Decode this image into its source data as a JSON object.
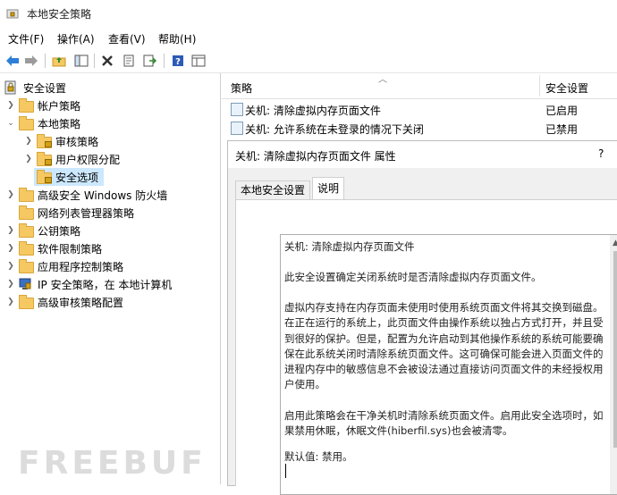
{
  "window": {
    "title": "本地安全策略"
  },
  "menu": [
    "文件(F)",
    "操作(A)",
    "查看(V)",
    "帮助(H)"
  ],
  "toolbar": {
    "icons": [
      "back-icon",
      "forward-icon",
      "up-folder-icon",
      "show-tree-icon",
      "delete-icon",
      "properties-icon",
      "export-icon",
      "help-icon",
      "view-icon"
    ]
  },
  "tree": {
    "root": "安全设置",
    "items": [
      {
        "label": "帐户策略",
        "level": 1,
        "expanded": false
      },
      {
        "label": "本地策略",
        "level": 1,
        "expanded": true
      },
      {
        "label": "审核策略",
        "level": 2,
        "expanded": false
      },
      {
        "label": "用户权限分配",
        "level": 2,
        "expanded": false
      },
      {
        "label": "安全选项",
        "level": 2,
        "selected": true
      },
      {
        "label": "高级安全 Windows 防火墙",
        "level": 1,
        "expanded": false
      },
      {
        "label": "网络列表管理器策略",
        "level": 1
      },
      {
        "label": "公钥策略",
        "level": 1,
        "expanded": false
      },
      {
        "label": "软件限制策略",
        "level": 1,
        "expanded": false
      },
      {
        "label": "应用程序控制策略",
        "level": 1,
        "expanded": false
      },
      {
        "label": "IP 安全策略，在 本地计算机",
        "level": 1,
        "expanded": false
      },
      {
        "label": "高级审核策略配置",
        "level": 1,
        "expanded": false
      }
    ]
  },
  "list": {
    "columns": [
      "策略",
      "安全设置"
    ],
    "rows": [
      {
        "name": "关机: 清除虚拟内存页面文件",
        "value": "已启用"
      },
      {
        "name": "关机: 允许系统在未登录的情况下关闭",
        "value": "已禁用"
      }
    ]
  },
  "dialog": {
    "title": "关机: 清除虚拟内存页面文件 属性",
    "help": "?",
    "tabs": [
      "本地安全设置",
      "说明"
    ],
    "active_tab": 1,
    "explain": {
      "p1": "关机: 清除虚拟内存页面文件",
      "p2": "此安全设置确定关闭系统时是否清除虚拟内存页面文件。",
      "p3": "虚拟内存支持在内存页面未使用时使用系统页面文件将其交换到磁盘。在正在运行的系统上，此页面文件由操作系统以独占方式打开，并且受到很好的保护。但是，配置为允许启动到其他操作系统的系统可能要确保在此系统关闭时清除系统页面文件。这可确保可能会进入页面文件的进程内存中的敏感信息不会被设法通过直接访问页面文件的未经授权用户使用。",
      "p4": "启用此策略会在干净关机时清除系统页面文件。启用此安全选项时，如果禁用休眠，休眠文件(hiberfil.sys)也会被清零。",
      "p5": "默认值: 禁用。"
    }
  },
  "watermark": "FREEBUF"
}
